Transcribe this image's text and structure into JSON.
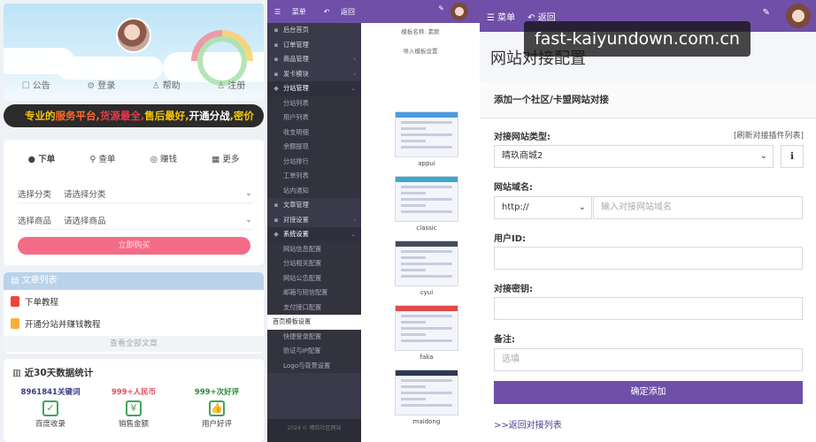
{
  "store": {
    "nav": [
      "公告",
      "登录",
      "帮助",
      "注册"
    ],
    "nav_icons": [
      "message-icon",
      "gear-icon",
      "user-icon",
      "user-icon"
    ],
    "marquee": [
      {
        "text": "专业的",
        "color": "#f5c400"
      },
      {
        "text": "服务平台,",
        "color": "#ff6a2a"
      },
      {
        "text": "货源最全,",
        "color": "#e8394a"
      },
      {
        "text": "售后最好,",
        "color": "#f5c400"
      },
      {
        "text": "开通分战",
        "color": "#ffffff"
      },
      {
        "text": ",密价",
        "color": "#f5c400"
      }
    ],
    "tabs": [
      "下单",
      "查单",
      "赚钱",
      "更多"
    ],
    "category_label": "选择分类",
    "category_value": "请选择分类",
    "product_label": "选择商品",
    "product_value": "请选择商品",
    "buy_label": "立即购买",
    "articles_title": "文章列表",
    "articles": [
      "下单教程",
      "开通分站并赚钱教程"
    ],
    "articles_more": "查看全部文章",
    "stats_title": "近30天数据统计",
    "stats": [
      {
        "value": "8961841关键词",
        "label": "百度收录"
      },
      {
        "value": "999+人民币",
        "label": "销售金额"
      },
      {
        "value": "999+次好评",
        "label": "用户好评"
      }
    ]
  },
  "admin": {
    "topbar": {
      "menu": "菜单",
      "back": "返回"
    },
    "menu": [
      {
        "label": "后台首页",
        "type": "top"
      },
      {
        "label": "订单管理",
        "type": "top"
      },
      {
        "label": "商品管理",
        "type": "top",
        "arrow": "‹"
      },
      {
        "label": "发卡模块",
        "type": "top",
        "arrow": "‹"
      },
      {
        "label": "分站管理",
        "type": "open",
        "arrow": "⌄"
      },
      {
        "label": "分站列表",
        "type": "sub"
      },
      {
        "label": "用户列表",
        "type": "sub"
      },
      {
        "label": "收支明细",
        "type": "sub"
      },
      {
        "label": "余额提现",
        "type": "sub"
      },
      {
        "label": "分站排行",
        "type": "sub"
      },
      {
        "label": "工单列表",
        "type": "sub"
      },
      {
        "label": "站内通知",
        "type": "sub"
      },
      {
        "label": "文章管理",
        "type": "top"
      },
      {
        "label": "对接设置",
        "type": "top",
        "arrow": "‹"
      },
      {
        "label": "系统设置",
        "type": "open",
        "arrow": "⌄"
      },
      {
        "label": "网站信息配置",
        "type": "sub"
      },
      {
        "label": "分站相关配置",
        "type": "sub"
      },
      {
        "label": "网站公告配置",
        "type": "sub"
      },
      {
        "label": "邮箱与短信配置",
        "type": "sub"
      },
      {
        "label": "支付接口配置",
        "type": "sub"
      },
      {
        "label": "首页模板设置",
        "type": "active"
      },
      {
        "label": "快捷登录配置",
        "type": "sub"
      },
      {
        "label": "验证与IP配置",
        "type": "sub"
      },
      {
        "label": "Logo与背景设置",
        "type": "sub"
      }
    ],
    "footer": "2024 © 晴玖社区网站",
    "template_name": "模板名称:  素颜",
    "import_label": "导入模板设置",
    "templates": [
      {
        "name": "appui",
        "bar": "#4a9be0"
      },
      {
        "name": "classic",
        "bar": "#3ea8c8"
      },
      {
        "name": "cyui",
        "bar": "#444b5c"
      },
      {
        "name": "faka",
        "bar": "#e24a4a"
      },
      {
        "name": "maidong",
        "bar": "#2d3a52"
      }
    ]
  },
  "docking": {
    "topbar": {
      "menu": "菜单",
      "back": "返回"
    },
    "title": "网站对接配置",
    "form_title": "添加一个社区/卡盟网站对接",
    "type_label": "对接网站类型:",
    "refresh": "[刷新对接插件列表]",
    "type_value": "晴玖商城2",
    "domain_label": "网站域名:",
    "protocol": "http://",
    "domain_placeholder": "输入对接网站域名",
    "userid_label": "用户ID:",
    "secret_label": "对接密钥:",
    "remark_label": "备注:",
    "remark_placeholder": "选填",
    "submit": "确定添加",
    "back_link": ">>返回对接列表"
  },
  "watermark": "fast-kaiyundown.com.cn",
  "colors": {
    "accent": "#6f4fa8",
    "sidebar": "#3a3a4a",
    "buy": "#f46b85"
  }
}
